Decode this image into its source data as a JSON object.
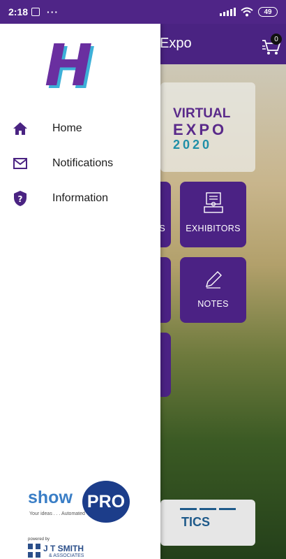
{
  "status_bar": {
    "time": "2:18",
    "more": "···",
    "battery": "49"
  },
  "app": {
    "title": "Expo",
    "cart_count": "0",
    "banner": {
      "line1": "VIRTUAL",
      "line2": "EXPO",
      "line3": "2020"
    },
    "tiles": {
      "partial_label": "S",
      "exhibitors": "EXHIBITORS",
      "notes": "NOTES"
    },
    "stats_label": "TICS"
  },
  "drawer": {
    "logo_letter": "H",
    "menu": [
      {
        "label": "Home",
        "icon": "home-icon"
      },
      {
        "label": "Notifications",
        "icon": "mail-icon"
      },
      {
        "label": "Information",
        "icon": "help-shield-icon"
      }
    ],
    "footer": {
      "show": "show",
      "pro": "PRO",
      "tagline": "Your ideas . . . Automated",
      "powered_by": "powered by",
      "company": "J T SMITH",
      "company_sub": "& ASSOCIATES"
    }
  },
  "colors": {
    "primary": "#4a2382",
    "accent": "#1f8fa8"
  }
}
